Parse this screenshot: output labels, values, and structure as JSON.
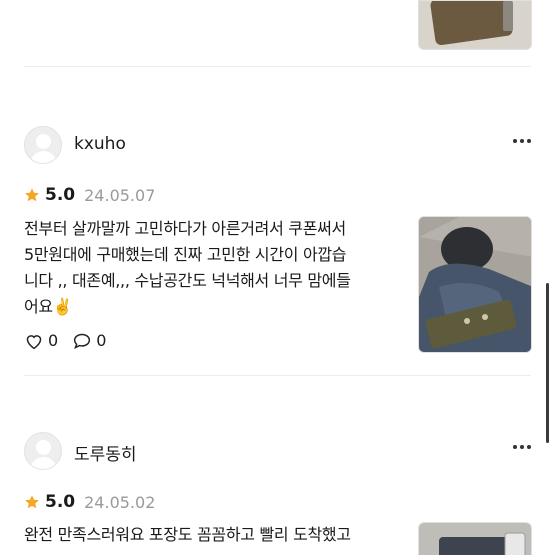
{
  "reviews": [
    {
      "username": "kxuho",
      "score": "5.0",
      "date": "24.05.07",
      "lines": [
        "전부터 살까말까 고민하다가 아른거려서 쿠폰써서",
        "5만원대에 구매했는데 진짜 고민한 시간이 아깝습",
        "니다 ,, 대존예,,, 수납공간도 넉넉해서 너무 맘에들",
        "어요✌️"
      ],
      "like_count": "0",
      "comment_count": "0"
    },
    {
      "username": "도루동히",
      "score": "5.0",
      "date": "24.05.02",
      "lines": [
        "완전 만족스러워요 포장도 꼼꼼하고 빨리 도착했고"
      ]
    }
  ],
  "colors": {
    "star": "#f5a623",
    "date": "#9a9a9a",
    "divider": "#ececec"
  },
  "icons": {
    "more": "more-horizontal-icon",
    "star": "star-icon",
    "like": "heart-icon",
    "comment": "comment-bubble-icon"
  }
}
